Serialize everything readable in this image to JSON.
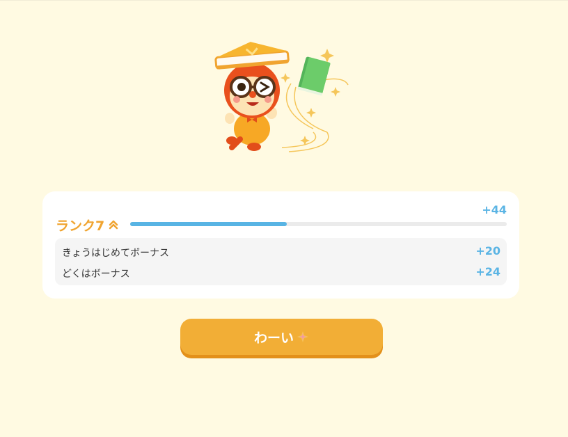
{
  "result": {
    "rank_label": "ランク7",
    "rank_up_icon": "double-chevron-up-icon",
    "total_gain": "+44",
    "progress_fraction": 0.415
  },
  "bonuses": [
    {
      "label": "きょうはじめてボーナス",
      "value": "+20"
    },
    {
      "label": "どくはボーナス",
      "value": "+24"
    }
  ],
  "cta": {
    "label": "わーい",
    "icon": "sparkle-icon"
  },
  "colors": {
    "background": "#fffae2",
    "accent_orange": "#f2ae36",
    "accent_blue": "#5ab4e4"
  }
}
